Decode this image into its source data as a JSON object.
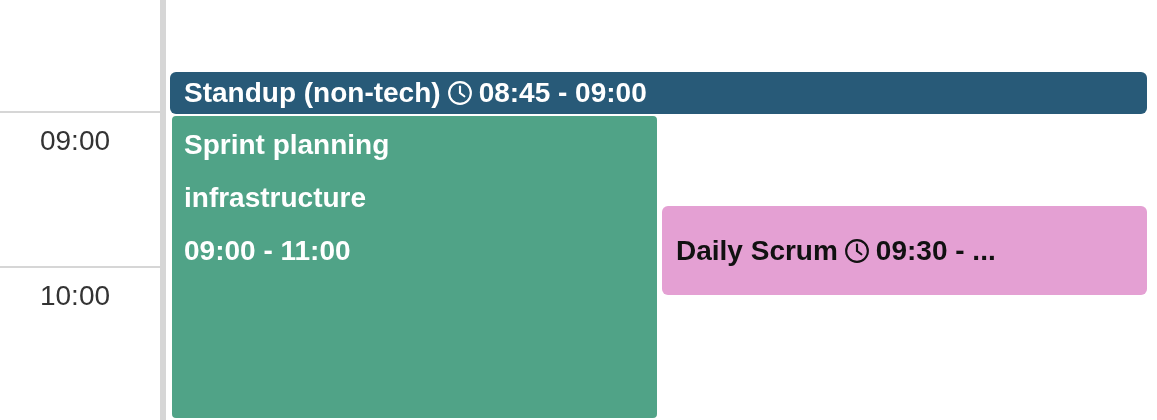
{
  "time_labels": [
    "09:00",
    "10:00"
  ],
  "events": [
    {
      "kind": "inline",
      "title": "Standup (non-tech)",
      "time": "08:45 - 09:00",
      "color": "#285a78",
      "clock": true
    },
    {
      "kind": "stacked",
      "title": "Sprint planning infrastructure",
      "time": "09:00 - 11:00",
      "color": "#50a387",
      "clock": false
    },
    {
      "kind": "inline",
      "title": "Daily Scrum",
      "time": "09:30 - ...",
      "color": "#e4a0d3",
      "clock": true
    }
  ]
}
